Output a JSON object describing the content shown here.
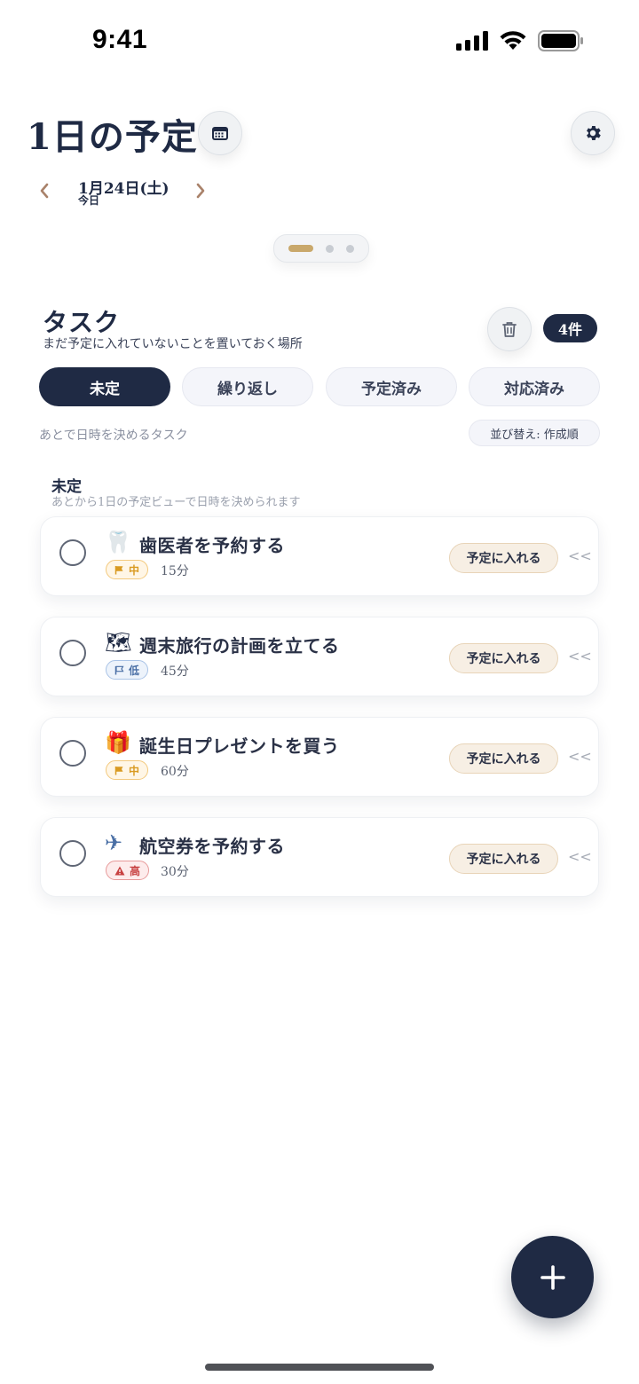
{
  "status_bar": {
    "time": "9:41"
  },
  "header": {
    "title": "1日の予定",
    "date": "1月24日(土)",
    "date_sub": "今日"
  },
  "section": {
    "title": "タスク",
    "subtitle": "まだ予定に入れていないことを置いておく場所",
    "count": "4件"
  },
  "tabs": [
    {
      "label": "未定",
      "active": true
    },
    {
      "label": "繰り返し",
      "active": false
    },
    {
      "label": "予定済み",
      "active": false
    },
    {
      "label": "対応済み",
      "active": false
    }
  ],
  "hint": "あとで日時を決めるタスク",
  "sort_label": "並び替え: 作成順",
  "group": {
    "title": "未定",
    "subtitle": "あとから1日の予定ビューで日時を決められます"
  },
  "tasks": [
    {
      "emoji": "🦷",
      "title": "歯医者を予約する",
      "priority": "中",
      "priority_level": "mid",
      "duration": "15分",
      "action": "予定に入れる",
      "swipe_hint": "<<"
    },
    {
      "emoji": "🗺",
      "title": "週末旅行の計画を立てる",
      "priority": "低",
      "priority_level": "low",
      "duration": "45分",
      "action": "予定に入れる",
      "swipe_hint": "<<"
    },
    {
      "emoji": "🎁",
      "title": "誕生日プレゼントを買う",
      "priority": "中",
      "priority_level": "mid",
      "duration": "60分",
      "action": "予定に入れる",
      "swipe_hint": "<<"
    },
    {
      "emoji": "✈",
      "title": "航空券を予約する",
      "priority": "高",
      "priority_level": "high",
      "duration": "30分",
      "action": "予定に入れる",
      "swipe_hint": "<<"
    }
  ],
  "colors": {
    "navy": "#1f2a44",
    "accent_gold": "#c9a86b",
    "priority_mid": "#d99a21",
    "priority_low": "#4a6fa5",
    "priority_high": "#c84141"
  }
}
